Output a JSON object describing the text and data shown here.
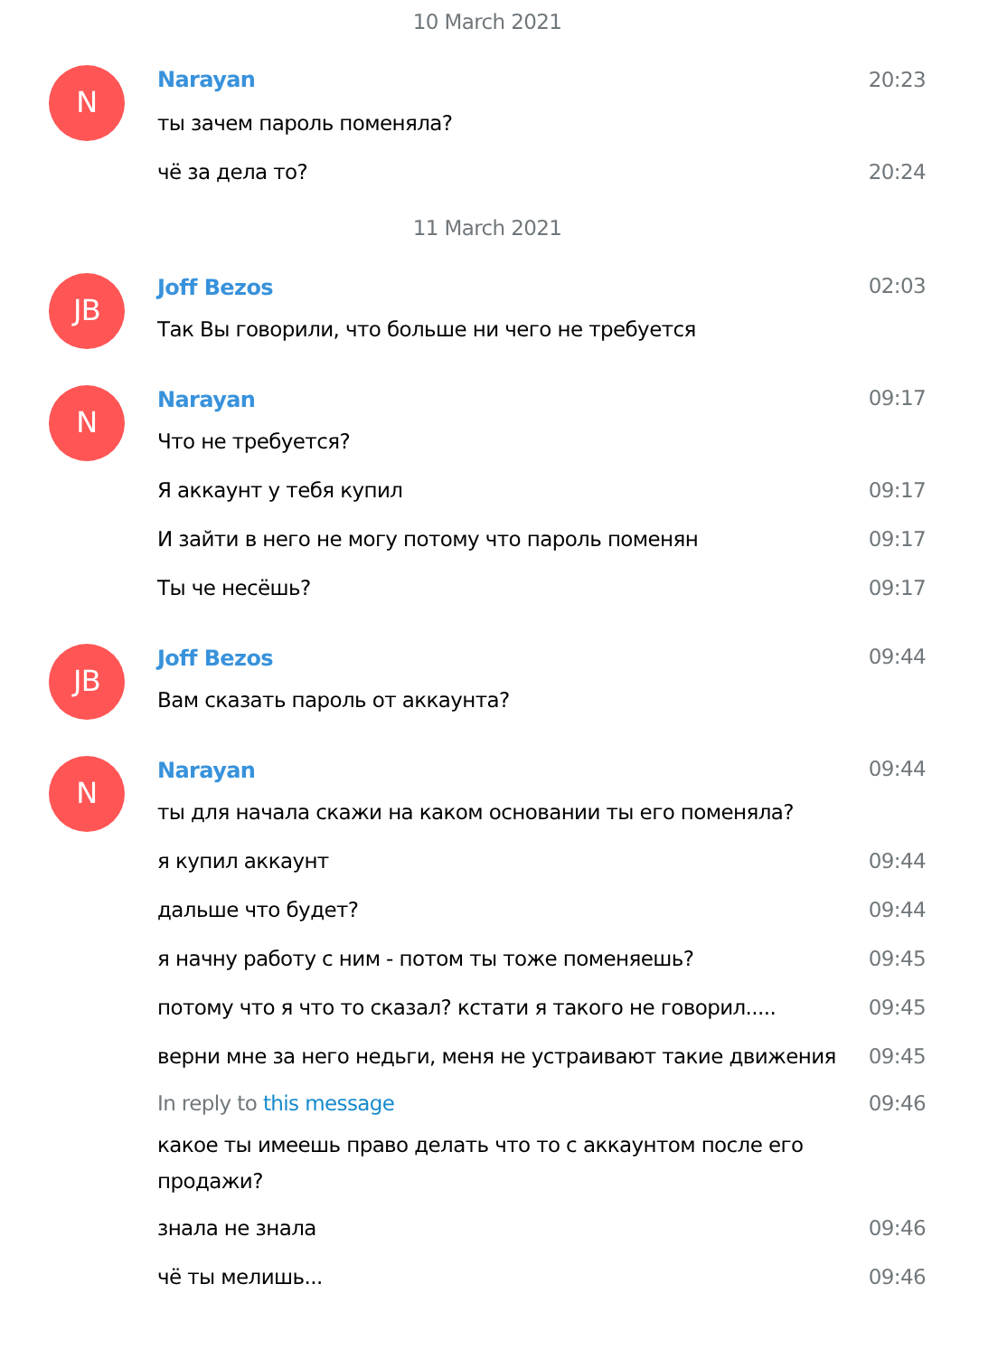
{
  "timeline": [
    {
      "kind": "date",
      "text": "10 March 2021"
    },
    {
      "kind": "group",
      "initials": "N",
      "name": "Narayan",
      "time": "20:23",
      "messages": [
        {
          "text": "ты зачем пароль поменяла?"
        },
        {
          "text": "чё за дела то?",
          "time": "20:24"
        }
      ]
    },
    {
      "kind": "date",
      "text": "11 March 2021"
    },
    {
      "kind": "group",
      "initials": "JB",
      "name": "Joff Bezos",
      "time": "02:03",
      "messages": [
        {
          "text": "Так Вы говорили, что больше ни чего не требуется"
        }
      ]
    },
    {
      "kind": "group",
      "initials": "N",
      "name": "Narayan",
      "time": "09:17",
      "messages": [
        {
          "text": "Что не требуется?"
        },
        {
          "text": "Я аккаунт у тебя купил",
          "time": "09:17"
        },
        {
          "text": "И зайти в него не могу потому что пароль поменян",
          "time": "09:17"
        },
        {
          "text": "Ты че несёшь?",
          "time": "09:17"
        }
      ]
    },
    {
      "kind": "group",
      "initials": "JB",
      "name": "Joff Bezos",
      "time": "09:44",
      "messages": [
        {
          "text": "Вам сказать пароль от аккаунта?"
        }
      ]
    },
    {
      "kind": "group",
      "initials": "N",
      "name": "Narayan",
      "time": "09:44",
      "messages": [
        {
          "text": "ты для начала скажи на каком основании ты его поменяла?"
        },
        {
          "text": "я купил аккаунт",
          "time": "09:44"
        },
        {
          "text": "дальше что будет?",
          "time": "09:44"
        },
        {
          "text": "я начну работу с ним - потом ты тоже поменяешь?",
          "time": "09:45"
        },
        {
          "text": "потому что я что то сказал? кстати я такого не говорил.....",
          "time": "09:45"
        },
        {
          "text": "верни мне за него недьги, меня не устраивают такие движения",
          "time": "09:45"
        },
        {
          "reply": {
            "prefix": "In reply to",
            "link": "this message"
          },
          "time": "09:46",
          "text": "какое ты имеешь право делать что то с аккаунтом после его продажи?"
        },
        {
          "text": "знала не знала",
          "time": "09:46"
        },
        {
          "text": "чё ты мелишь...",
          "time": "09:46"
        }
      ]
    }
  ]
}
